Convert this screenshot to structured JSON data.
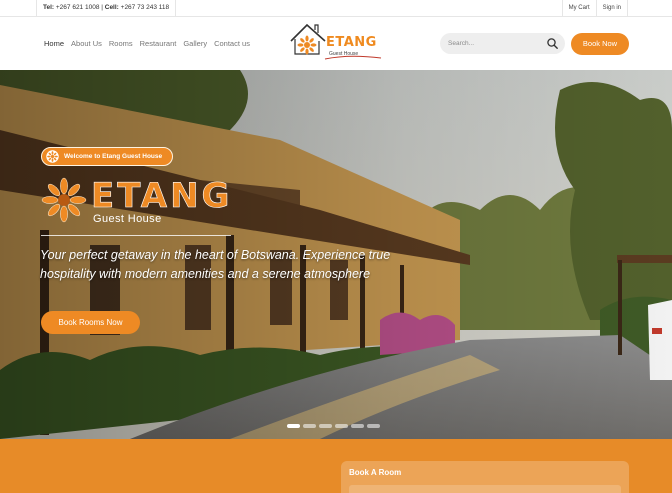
{
  "topbar": {
    "tel_label": "Tel:",
    "tel_value": " +267 621 1008 | ",
    "cell_label": "Cell:",
    "cell_value": " +267 73 243 118",
    "my_cart": "My Cart",
    "sign_in": "Sign in"
  },
  "nav": {
    "items": [
      "Home",
      "About Us",
      "Rooms",
      "Restaurant",
      "Gallery",
      "Contact us"
    ]
  },
  "logo": {
    "brand": "ETANG",
    "tagline": "Guest House"
  },
  "search": {
    "placeholder": "Search..."
  },
  "header": {
    "book_now": "Book Now"
  },
  "hero": {
    "welcome": "Welcome to Etang Guest House",
    "brand": "ETANG",
    "sub": "Guest House",
    "tagline": "Your perfect getaway in the heart of Botswana. Experience true hospitality with modern amenities and a serene atmosphere",
    "button": "Book Rooms Now",
    "slides": 6,
    "active_slide": 1
  },
  "booking": {
    "title": "Book A Room"
  },
  "colors": {
    "accent": "#ee8a24",
    "band": "#e78b28"
  }
}
